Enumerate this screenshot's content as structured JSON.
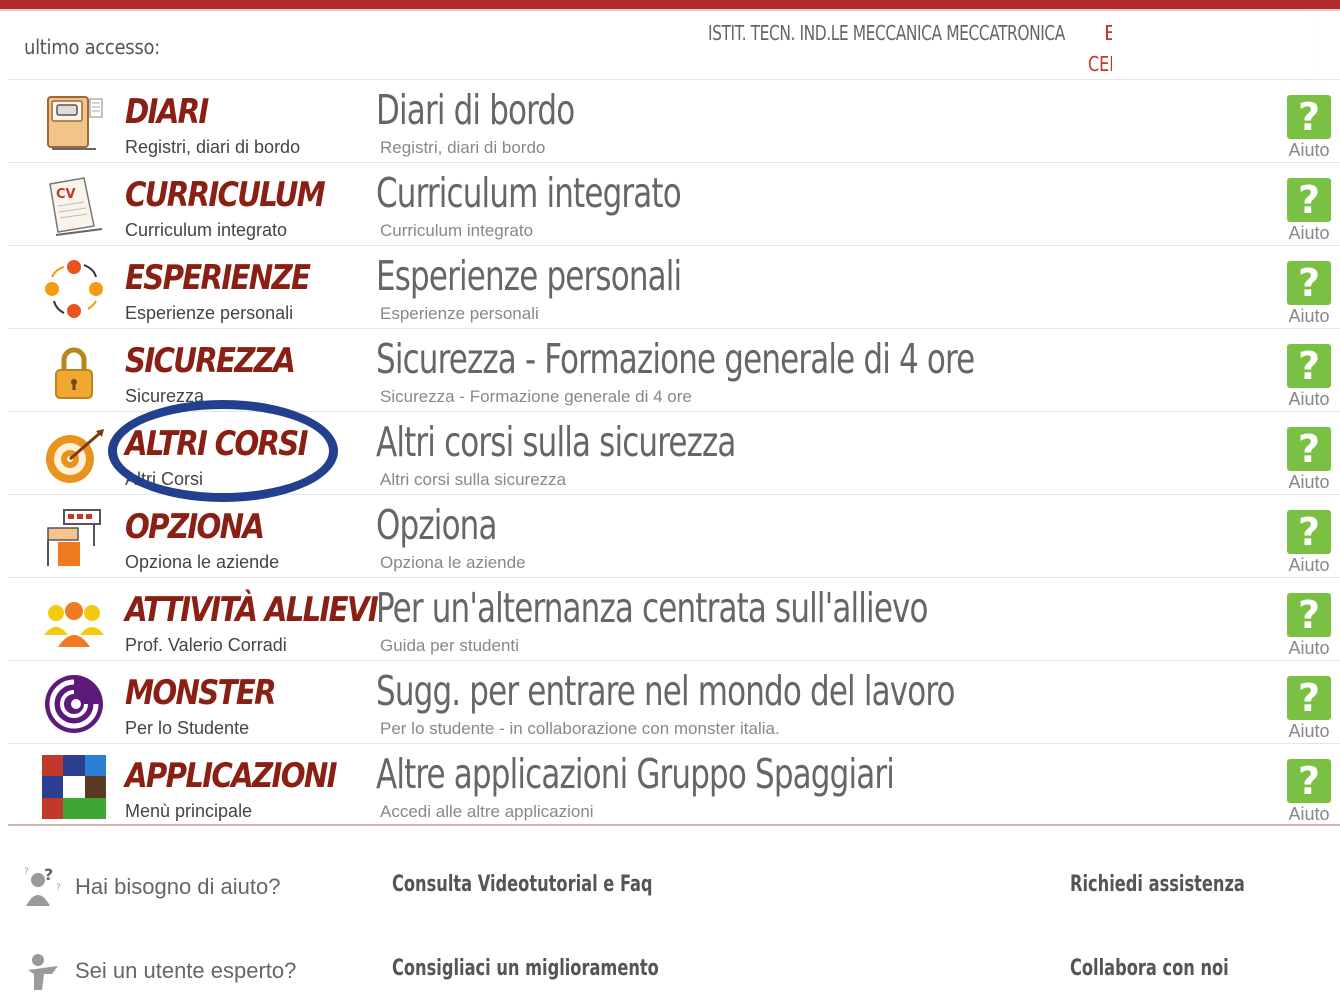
{
  "header": {
    "last_access_label": "ultimo accesso:",
    "school_name": "ISTIT. TECN. IND.LE MECCANICA MECCATRONICA",
    "school_name_tail": "E",
    "school_code": "CEI"
  },
  "rows": [
    {
      "title": "DIARI",
      "subtitle": "Registri, diari di bordo",
      "description": "Diari di bordo",
      "description_sub": "Registri, diari di bordo",
      "help_label": "Aiuto",
      "icon": "notebook-icon"
    },
    {
      "title": "CURRICULUM",
      "subtitle": "Curriculum integrato",
      "description": "Curriculum integrato",
      "description_sub": "Curriculum integrato",
      "help_label": "Aiuto",
      "icon": "cv-document-icon"
    },
    {
      "title": "ESPERIENZE",
      "subtitle": "Esperienze personali",
      "description": "Esperienze personali",
      "description_sub": "Esperienze personali",
      "help_label": "Aiuto",
      "icon": "cycle-icon"
    },
    {
      "title": "SICUREZZA",
      "subtitle": "Sicurezza",
      "description": "Sicurezza - Formazione generale di 4 ore",
      "description_sub": "Sicurezza - Formazione generale di 4 ore",
      "help_label": "Aiuto",
      "icon": "padlock-icon"
    },
    {
      "title": "ALTRI CORSI",
      "subtitle": "Altri Corsi",
      "description": "Altri corsi sulla sicurezza",
      "description_sub": "Altri corsi sulla sicurezza",
      "help_label": "Aiuto",
      "icon": "target-icon"
    },
    {
      "title": "OPZIONA",
      "subtitle": "Opziona le aziende",
      "description": "Opziona",
      "description_sub": "Opziona le aziende",
      "help_label": "Aiuto",
      "icon": "blocks-icon"
    },
    {
      "title": "ATTIVITÀ ALLIEVI",
      "subtitle": "Prof. Valerio Corradi",
      "description": "Per un'alternanza centrata sull'allievo",
      "description_sub": "Guida per studenti",
      "help_label": "Aiuto",
      "icon": "students-icon"
    },
    {
      "title": "MONSTER",
      "subtitle": "Per lo Studente",
      "description": "Sugg. per entrare nel mondo del lavoro",
      "description_sub": "Per lo studente - in collaborazione con monster italia.",
      "help_label": "Aiuto",
      "icon": "monster-logo-icon"
    },
    {
      "title": "APPLICAZIONI",
      "subtitle": "Menù principale",
      "description": "Altre applicazioni Gruppo Spaggiari",
      "description_sub": "Accedi alle altre applicazioni",
      "help_label": "Aiuto",
      "icon": "app-grid-icon"
    }
  ],
  "footer": {
    "help_question": "Hai bisogno di aiuto?",
    "help_link": "Consulta Videotutorial e Faq",
    "help_link_right": "Richiedi assistenza",
    "expert_question": "Sei un utente esperto?",
    "expert_link": "Consigliaci un miglioramento",
    "expert_link_right": "Collabora con noi"
  },
  "colors": {
    "title_red": "#8a2014",
    "help_green": "#7ac143",
    "highlight_blue": "#23408e",
    "top_bar": "#b22a2a"
  }
}
